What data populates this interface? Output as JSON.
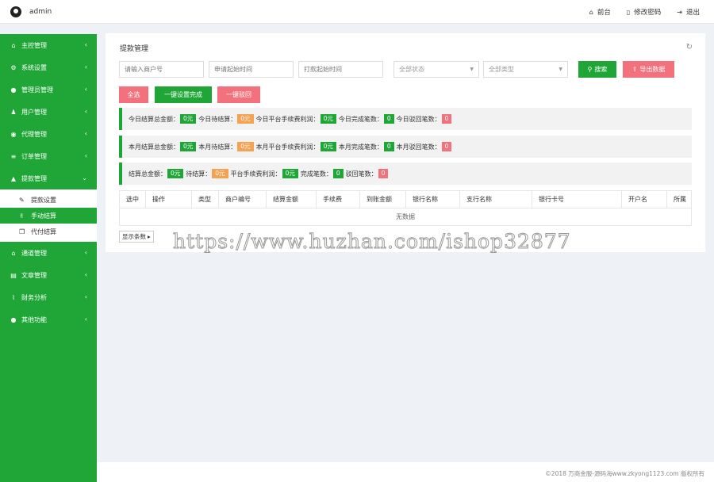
{
  "header": {
    "username": "admin",
    "links": [
      {
        "icon": "home-icon",
        "label": "前台"
      },
      {
        "icon": "file-icon",
        "label": "修改密码"
      },
      {
        "icon": "logout-icon",
        "label": "退出"
      }
    ]
  },
  "sidebar": {
    "items": [
      {
        "icon": "home-icon",
        "label": "主控管理"
      },
      {
        "icon": "gears-icon",
        "label": "系统设置"
      },
      {
        "icon": "user-circle-icon",
        "label": "管理员管理"
      },
      {
        "icon": "users-icon",
        "label": "用户管理"
      },
      {
        "icon": "eye-icon",
        "label": "代理管理"
      },
      {
        "icon": "list-icon",
        "label": "订单管理"
      },
      {
        "icon": "lock-icon",
        "label": "提款管理"
      }
    ],
    "submenu": [
      {
        "icon": "wrench-icon",
        "label": "提款设置"
      },
      {
        "icon": "handshake-icon",
        "label": "手动结算"
      },
      {
        "icon": "clone-icon",
        "label": "代付结算"
      }
    ],
    "items_after": [
      {
        "icon": "bank-icon",
        "label": "通道管理"
      },
      {
        "icon": "book-icon",
        "label": "文章管理"
      },
      {
        "icon": "chart-icon",
        "label": "财务分析"
      },
      {
        "icon": "user-circle-icon",
        "label": "其他功能"
      }
    ],
    "colors": {
      "bg": "#1fa637"
    }
  },
  "panel": {
    "title": "提款管理",
    "filters": {
      "merchant_placeholder": "请输入商户号",
      "apply_time_placeholder": "申请起始时间",
      "pay_time_placeholder": "打款起始时间",
      "status_selected": "全部状态",
      "type_selected": "全部类型"
    },
    "buttons": {
      "search": "搜索",
      "export": "导出数据",
      "select_all": "全选",
      "set_complete": "一键设置完成",
      "reject": "一键驳回"
    },
    "stats": {
      "today": {
        "total_label": "今日结算总金额：",
        "total": "0元",
        "pending_label": "今日待结算：",
        "pending": "0元",
        "profit_label": "今日平台手续费利润：",
        "profit": "0元",
        "done_label": "今日完成笔数：",
        "done": "0",
        "rejected_label": "今日驳回笔数：",
        "rejected": "0"
      },
      "month": {
        "total_label": "本月结算总金额：",
        "total": "0元",
        "pending_label": "本月待结算：",
        "pending": "0元",
        "profit_label": "本月平台手续费利润：",
        "profit": "0元",
        "done_label": "本月完成笔数：",
        "done": "0",
        "rejected_label": "本月驳回笔数：",
        "rejected": "0"
      },
      "all": {
        "total_label": "结算总金额：",
        "total": "0元",
        "pending_label": "待结算：",
        "pending": "0元",
        "profit_label": "平台手续费利润：",
        "profit": "0元",
        "done_label": "完成笔数：",
        "done": "0",
        "rejected_label": "驳回笔数：",
        "rejected": "0"
      }
    },
    "table": {
      "columns": [
        "选中",
        "操作",
        "类型",
        "商户编号",
        "结算金额",
        "手续费",
        "到账金额",
        "银行名称",
        "支行名称",
        "银行卡号",
        "开户名",
        "所属"
      ],
      "empty_text": "无数据"
    },
    "page_size_label": "显示条数"
  },
  "watermark": "https://www.huzhan.com/ishop32877",
  "footer": {
    "copyright": "©2018 万商金服-源码海www.zkyong1123.com 版权所有"
  }
}
